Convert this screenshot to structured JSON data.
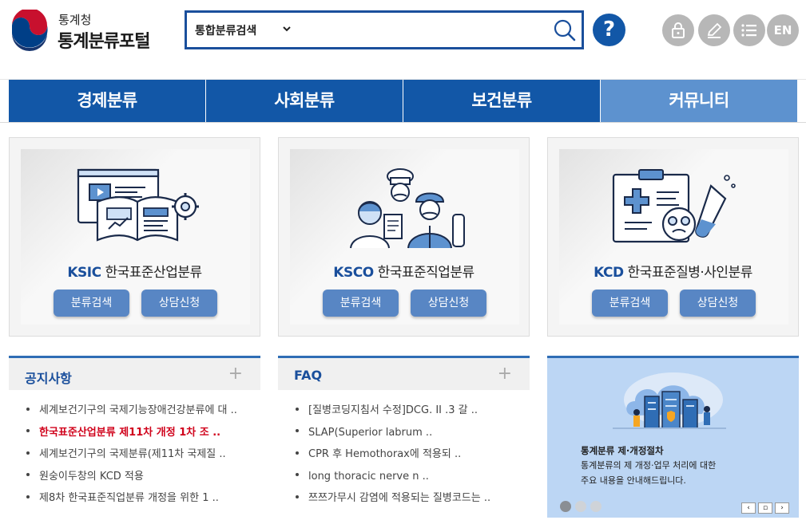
{
  "logo": {
    "org": "통계청",
    "site": "통계분류포털"
  },
  "search": {
    "category": "통합분류검색",
    "value": "",
    "placeholder": ""
  },
  "help": {
    "symbol": "?"
  },
  "utility": {
    "lang": "EN"
  },
  "gnb": [
    "경제분류",
    "사회분류",
    "보건분류",
    "커뮤니티"
  ],
  "cards": [
    {
      "code": "KSIC",
      "name": "한국표준산업분류",
      "btn_search": "분류검색",
      "btn_consult": "상담신청"
    },
    {
      "code": "KSCO",
      "name": "한국표준직업분류",
      "btn_search": "분류검색",
      "btn_consult": "상담신청"
    },
    {
      "code": "KCD",
      "name": "한국표준질병·사인분류",
      "btn_search": "분류검색",
      "btn_consult": "상담신청"
    }
  ],
  "notice": {
    "title": "공지사항",
    "more": "+",
    "items": [
      "세계보건기구의 국제기능장애건강분류에 대 ..",
      "한국표준산업분류 제11차 개정 1차 조 ..",
      "세계보건기구의 국제분류(제11차 국제질 ..",
      "원숭이두창의 KCD 적용",
      "제8차 한국표준직업분류 개정을 위한 1 .."
    ]
  },
  "faq": {
    "title": "FAQ",
    "more": "+",
    "items": [
      "[질병코딩지침서 수정]DCG. II .3 갈 ..",
      "SLAP(Superior labrum ..",
      "CPR 후 Hemothorax에 적용되 ..",
      "long thoracic nerve n ..",
      "쯔쯔가무시 감염에 적용되는 질병코드는 .."
    ]
  },
  "banner": {
    "title": "통계분류 제·개정절차",
    "desc1": "통계분류의 제 개정·업무 처리에 대한",
    "desc2": "주요 내용을 안내해드립니다.",
    "ctrl_prev": "‹",
    "ctrl_stop": "▫",
    "ctrl_next": "›"
  },
  "colors": {
    "primary": "#1257a7",
    "gnb_active": "#5d92cf",
    "button": "#5886c4",
    "hot": "#d0021b"
  }
}
